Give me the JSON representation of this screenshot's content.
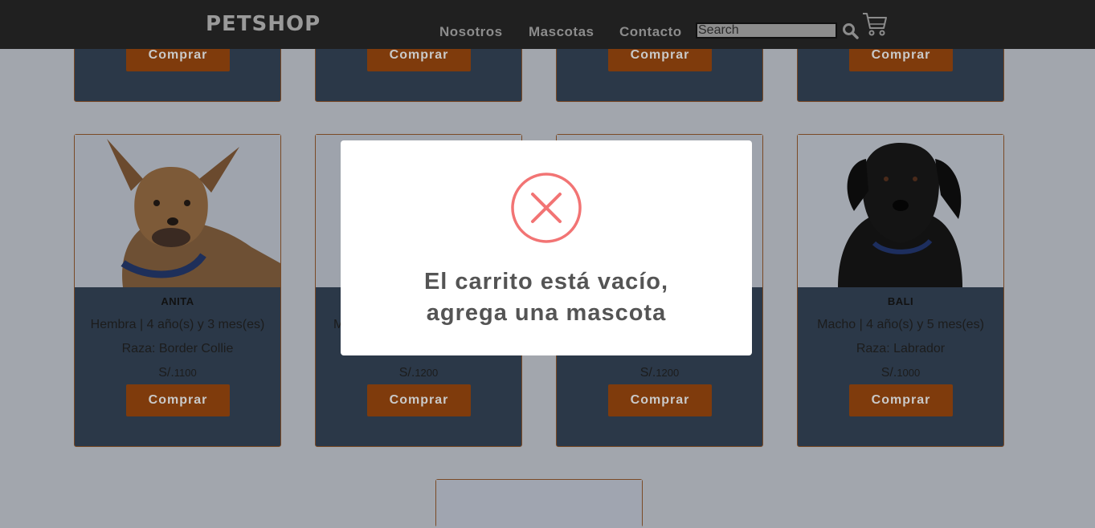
{
  "header": {
    "logo": "PETSHOP",
    "nav": [
      "Nosotros",
      "Mascotas",
      "Contacto"
    ],
    "search_placeholder": "Search",
    "search_icon": "search-icon",
    "cart_icon": "shopping-cart-icon"
  },
  "top_row_cards": [
    {
      "buy_label": "Comprar"
    },
    {
      "buy_label": "Comprar"
    },
    {
      "buy_label": "Comprar"
    },
    {
      "buy_label": "Comprar"
    }
  ],
  "pets": [
    {
      "name": "ANITA",
      "info": "Hembra | 4 año(s) y 3 mes(es)",
      "breed": "Raza: Border Collie",
      "currency": "S/.",
      "price": "1100",
      "buy_label": "Comprar"
    },
    {
      "name": "",
      "info": "M",
      "breed": "",
      "currency": "S/.",
      "price": "1200",
      "buy_label": "Comprar"
    },
    {
      "name": "",
      "info": "",
      "breed": "",
      "currency": "S/.",
      "price": "1200",
      "buy_label": "Comprar"
    },
    {
      "name": "BALI",
      "info": "Macho | 4 año(s) y 5 mes(es)",
      "breed": "Raza: Labrador",
      "currency": "S/.",
      "price": "1000",
      "buy_label": "Comprar"
    }
  ],
  "modal": {
    "icon": "error-x-icon",
    "line1": "El carrito está vacío,",
    "line2": "agrega una mascota",
    "accent_color": "#f27474"
  }
}
